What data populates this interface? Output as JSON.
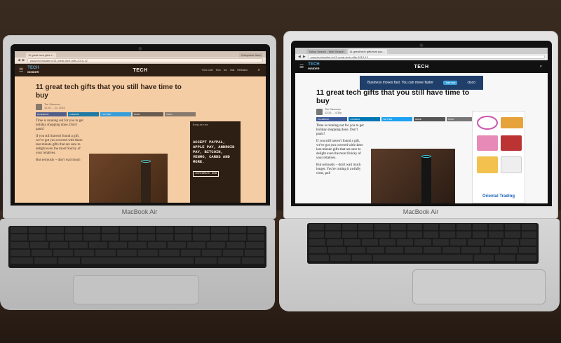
{
  "brand": {
    "laptop_label": "MacBook Air"
  },
  "left_screen": {
    "browser": {
      "tab_active": "11 great tech gifts t...",
      "url": "www.techinsider.io/11-great-tech-gifts-2015-12",
      "tab_right": "Composer User"
    },
    "site": {
      "logo_top": "TECH",
      "logo_bottom": "INSIDER",
      "section": "TECH",
      "nav_links": [
        "YOU CAN",
        "Tech",
        "Sci",
        "Vids",
        "Releases"
      ]
    },
    "article": {
      "headline": "11 great tech gifts that you still have time to buy",
      "author": "Tim Stenovec",
      "timestamp": "12:26 ... 21, 2015",
      "share_buttons": [
        "FACEBOOK",
        "LINKEDIN",
        "TWITTER",
        "EMAIL",
        "PRINT"
      ],
      "paragraphs": [
        "Time is running out for you to get holiday shopping done. Don't panic!",
        "If you still haven't found a gift, we've got you covered with these last-minute gifts that are sure to delight even the most finicky of your relatives.",
        "But seriously – don't wait much"
      ]
    },
    "side_ad": {
      "brand": "Braintree",
      "copy": "ACCEPT PAYPAL, APPLE PAY, ANDROID PAY, BITCOIN, VENMO, CARDS AND MORE.",
      "button": "INTEGRATE NOW"
    }
  },
  "right_screen": {
    "browser": {
      "tab_inactive": "Yahoo Search - Web Search",
      "tab_active": "11 great tech gifts that you...",
      "url": "www.techinsider.io/11-great-tech-gifts-2015-12"
    },
    "site": {
      "logo_top": "TECH",
      "logo_bottom": "INSIDER",
      "section": "TECH"
    },
    "banner_ad": {
      "copy": "Business moves fast. You can move faster",
      "button": "Take tour",
      "brand": "cisco"
    },
    "article": {
      "headline": "11 great tech gifts that you still have time to buy",
      "author": "Tim Stenovec",
      "timestamp": "12:26 ... 4:33p",
      "share_buttons": [
        "FACEBOOK",
        "LINKEDIN",
        "TWITTER",
        "EMAIL",
        "PRINT"
      ],
      "paragraphs": [
        "Time is running out for you to get holiday shopping done. Don't panic!",
        "If you still haven't found a gift, we've got you covered with these last-minute gifts that are sure to delight even the most finicky of your relatives.",
        "But seriously – don't wait much longer. You're cutting it awfully close, pal!"
      ]
    },
    "side_ad": {
      "brand": "Oriental Trading"
    }
  },
  "colors": {
    "share_facebook": "#3b5998",
    "share_linkedin": "#0077b5",
    "share_twitter": "#1da1f2",
    "share_email": "#555555",
    "share_print": "#777777",
    "echo_ring": "#3fd3e0"
  }
}
